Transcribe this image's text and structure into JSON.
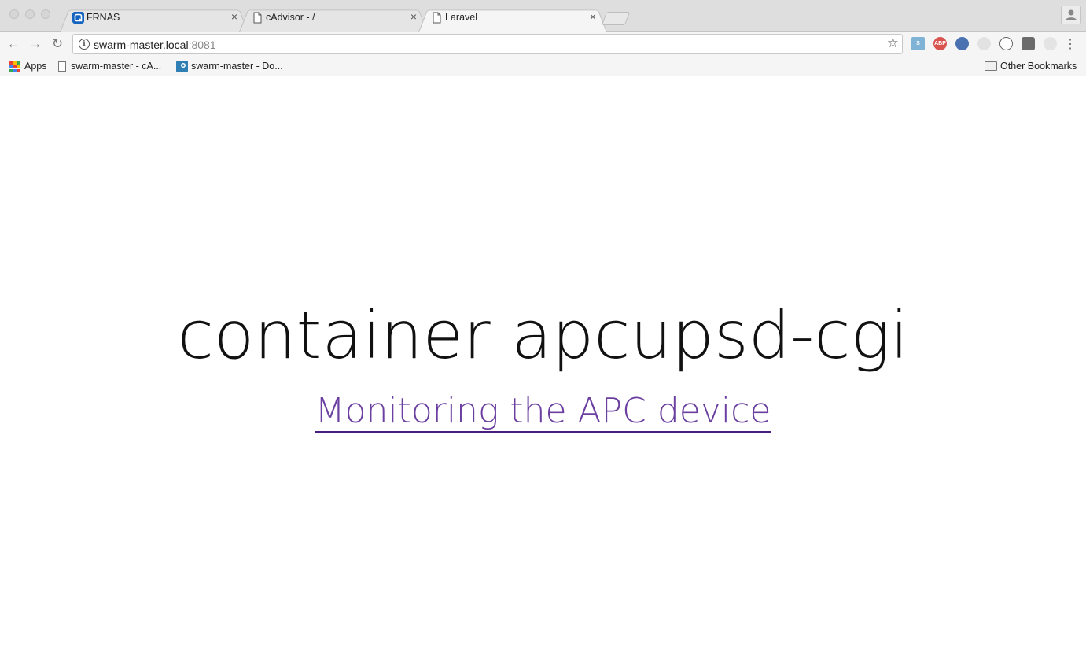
{
  "tabs": [
    {
      "title": "FRNAS",
      "favicon": "frnas-app-icon",
      "active": false
    },
    {
      "title": "cAdvisor - /",
      "favicon": "page-icon",
      "active": false
    },
    {
      "title": "Laravel",
      "favicon": "page-icon",
      "active": true
    }
  ],
  "tab_close_glyph": "×",
  "toolbar": {
    "url_host": "swarm-master.local",
    "url_port": ":8081",
    "back_glyph": "←",
    "forward_glyph": "→",
    "reload_glyph": "↻",
    "star_glyph": "☆",
    "menu_glyph": "⋮",
    "extensions": [
      {
        "name": "sheets-extension-icon",
        "label": "S",
        "color": "#7fb3d5"
      },
      {
        "name": "adblock-plus-icon",
        "label": "ABP",
        "color": "#d9534f"
      },
      {
        "name": "globe-extension-icon",
        "label": "",
        "color": "#4a72b0"
      },
      {
        "name": "fingerprint-extension-icon",
        "label": "",
        "color": "#d0d0d0"
      },
      {
        "name": "onepassword-icon",
        "label": "",
        "color": "#777777"
      },
      {
        "name": "evernote-icon",
        "label": "",
        "color": "#6b6b6b"
      },
      {
        "name": "feather-extension-icon",
        "label": "",
        "color": "#dcdcdc"
      }
    ]
  },
  "bookmarks": {
    "apps_label": "Apps",
    "items": [
      {
        "label": "swarm-master - cA...",
        "icon": "page-icon"
      },
      {
        "label": "swarm-master - Do...",
        "icon": "docker-icon"
      }
    ],
    "other_label": "Other Bookmarks"
  },
  "page": {
    "heading": "container apcupsd-cgi",
    "link_text": "Monitoring the APC device"
  },
  "colors": {
    "link": "#6a3fa0",
    "link_underline": "#4a1e7e",
    "frnas_blue": "#1565c0"
  }
}
